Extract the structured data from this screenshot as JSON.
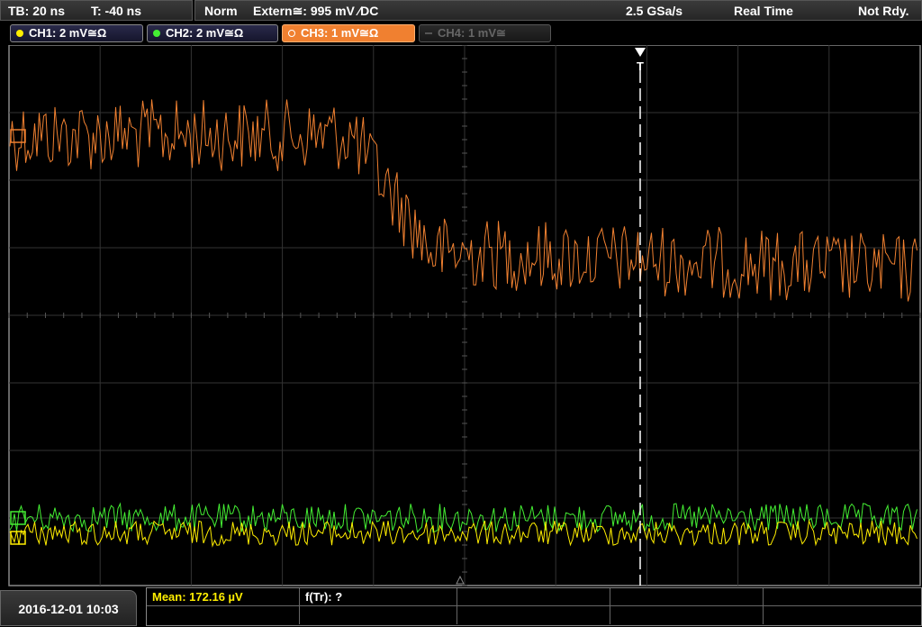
{
  "status_bar": {
    "timebase": "TB: 20 ns",
    "trigger_offset": "T: -40 ns",
    "acq_mode": "Norm",
    "trigger_source": "Extern≅: 995 mV ∕DC",
    "sample_rate": "2.5 GSa/s",
    "sampling": "Real Time",
    "state": "Not Rdy."
  },
  "channels": [
    {
      "id": "ch1",
      "label": "CH1: 2 mV≅Ω",
      "color": "#ffee00",
      "active": true
    },
    {
      "id": "ch2",
      "label": "CH2: 2 mV≅Ω",
      "color": "#44ee33",
      "active": true
    },
    {
      "id": "ch3",
      "label": "CH3: 1 mV≅Ω",
      "color": "#f08030",
      "active": true
    },
    {
      "id": "ch4",
      "label": "CH4: 1 mV≅",
      "color": "#777777",
      "active": false
    }
  ],
  "trigger_marker": "T",
  "measurements": {
    "mean": "Mean: 172.16 µV",
    "freq": "f(Tr): ?"
  },
  "datetime": "2016-12-01 10:03"
}
